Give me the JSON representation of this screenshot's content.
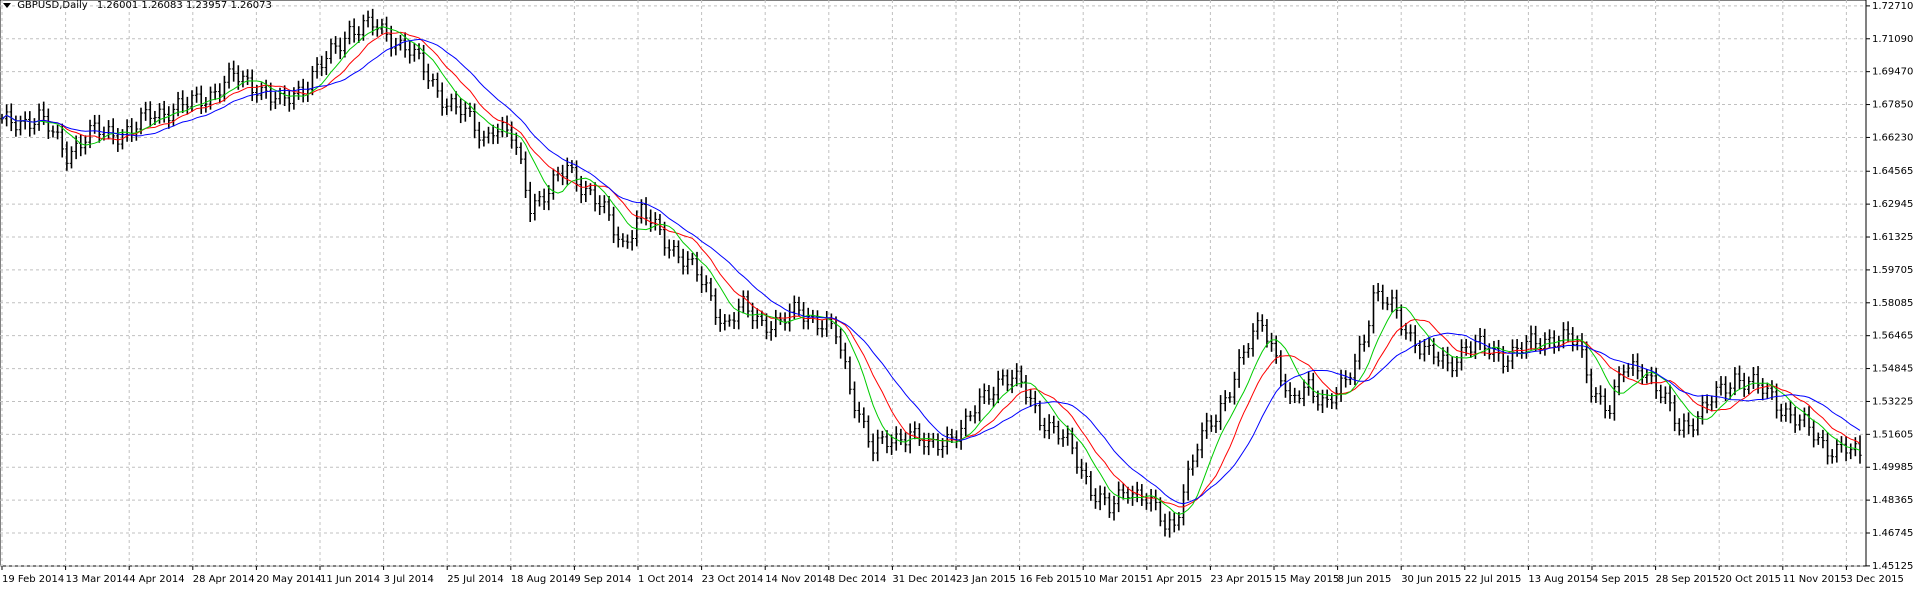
{
  "header": {
    "symbol": "GBPUSD,Daily",
    "prices": "1.26001 1.26083 1.23957 1.26073"
  },
  "chart_data": {
    "type": "candlestick",
    "symbol": "GBPUSD",
    "timeframe": "Daily",
    "grid": true,
    "y_axis": {
      "position": "right",
      "ylim": [
        1.4512,
        1.73
      ],
      "tick_labels": [
        "1.72710",
        "1.71090",
        "1.69470",
        "1.67850",
        "1.66230",
        "1.64565",
        "1.62945",
        "1.61325",
        "1.59705",
        "1.58085",
        "1.56465",
        "1.54845",
        "1.53225",
        "1.51605",
        "1.49985",
        "1.48365",
        "1.46745",
        "1.45125"
      ]
    },
    "x_axis": {
      "tick_labels": [
        "19 Feb 2014",
        "13 Mar 2014",
        "4 Apr 2014",
        "28 Apr 2014",
        "20 May 2014",
        "11 Jun 2014",
        "3 Jul 2014",
        "25 Jul 2014",
        "18 Aug 2014",
        "9 Sep 2014",
        "1 Oct 2014",
        "23 Oct 2014",
        "14 Nov 2014",
        "8 Dec 2014",
        "31 Dec 2014",
        "23 Jan 2015",
        "16 Feb 2015",
        "10 Mar 2015",
        "1 Apr 2015",
        "23 Apr 2015",
        "15 May 2015",
        "8 Jun 2015",
        "30 Jun 2015",
        "22 Jul 2015",
        "13 Aug 2015",
        "4 Sep 2015",
        "28 Sep 2015",
        "20 Oct 2015",
        "11 Nov 2015",
        "3 Dec 2015"
      ]
    },
    "series": [
      {
        "name": "",
        "kind": "moving-average",
        "color": "#ff0000"
      },
      {
        "name": "",
        "kind": "moving-average",
        "color": "#00cc00"
      },
      {
        "name": "",
        "kind": "moving-average",
        "color": "#0000ff"
      }
    ],
    "close_path": [
      [
        0,
        1.669
      ],
      [
        8,
        1.672
      ],
      [
        14,
        1.655
      ],
      [
        20,
        1.665
      ],
      [
        28,
        1.665
      ],
      [
        32,
        1.674
      ],
      [
        40,
        1.678
      ],
      [
        45,
        1.684
      ],
      [
        50,
        1.692
      ],
      [
        55,
        1.688
      ],
      [
        60,
        1.678
      ],
      [
        65,
        1.688
      ],
      [
        70,
        1.7
      ],
      [
        75,
        1.716
      ],
      [
        80,
        1.717
      ],
      [
        84,
        1.712
      ],
      [
        88,
        1.705
      ],
      [
        92,
        1.692
      ],
      [
        96,
        1.68
      ],
      [
        100,
        1.673
      ],
      [
        104,
        1.662
      ],
      [
        106,
        1.668
      ],
      [
        110,
        1.662
      ],
      [
        112,
        1.648
      ],
      [
        114,
        1.63
      ],
      [
        118,
        1.635
      ],
      [
        122,
        1.648
      ],
      [
        126,
        1.637
      ],
      [
        130,
        1.625
      ],
      [
        134,
        1.61
      ],
      [
        138,
        1.625
      ],
      [
        140,
        1.62
      ],
      [
        144,
        1.61
      ],
      [
        148,
        1.6
      ],
      [
        152,
        1.588
      ],
      [
        156,
        1.57
      ],
      [
        160,
        1.578
      ],
      [
        164,
        1.572
      ],
      [
        168,
        1.57
      ],
      [
        172,
        1.578
      ],
      [
        176,
        1.572
      ],
      [
        180,
        1.565
      ],
      [
        183,
        1.54
      ],
      [
        188,
        1.508
      ],
      [
        192,
        1.513
      ],
      [
        196,
        1.518
      ],
      [
        200,
        1.508
      ],
      [
        204,
        1.515
      ],
      [
        208,
        1.52
      ],
      [
        212,
        1.535
      ],
      [
        216,
        1.545
      ],
      [
        220,
        1.54
      ],
      [
        224,
        1.525
      ],
      [
        227,
        1.518
      ],
      [
        231,
        1.508
      ],
      [
        235,
        1.49
      ],
      [
        239,
        1.478
      ],
      [
        243,
        1.49
      ],
      [
        247,
        1.485
      ],
      [
        251,
        1.47
      ],
      [
        253,
        1.472
      ],
      [
        255,
        1.49
      ],
      [
        258,
        1.51
      ],
      [
        262,
        1.525
      ],
      [
        265,
        1.54
      ],
      [
        268,
        1.555
      ],
      [
        272,
        1.572
      ],
      [
        275,
        1.555
      ],
      [
        278,
        1.53
      ],
      [
        282,
        1.54
      ],
      [
        286,
        1.532
      ],
      [
        290,
        1.54
      ],
      [
        294,
        1.565
      ],
      [
        296,
        1.585
      ],
      [
        300,
        1.578
      ],
      [
        304,
        1.565
      ],
      [
        308,
        1.555
      ],
      [
        312,
        1.55
      ],
      [
        316,
        1.56
      ],
      [
        320,
        1.558
      ],
      [
        324,
        1.555
      ],
      [
        328,
        1.558
      ],
      [
        332,
        1.562
      ],
      [
        336,
        1.565
      ],
      [
        340,
        1.56
      ],
      [
        343,
        1.54
      ],
      [
        347,
        1.528
      ],
      [
        350,
        1.548
      ],
      [
        354,
        1.55
      ],
      [
        358,
        1.535
      ],
      [
        362,
        1.52
      ],
      [
        366,
        1.525
      ],
      [
        370,
        1.535
      ],
      [
        374,
        1.545
      ],
      [
        378,
        1.54
      ],
      [
        382,
        1.535
      ],
      [
        386,
        1.525
      ],
      [
        390,
        1.518
      ],
      [
        394,
        1.51
      ],
      [
        398,
        1.508
      ],
      [
        401,
        1.505
      ]
    ],
    "annotation": "daily OHLC bars with three moving averages (red, green, blue)"
  }
}
